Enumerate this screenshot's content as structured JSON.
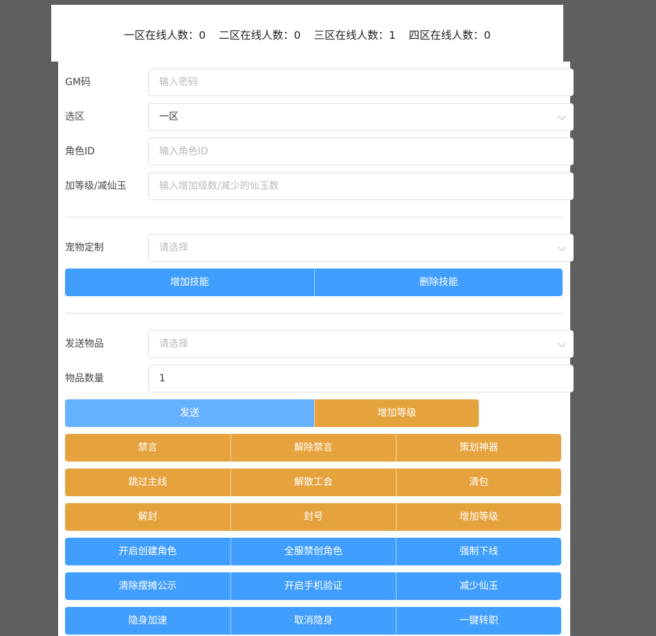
{
  "stats": [
    "一区在线人数：0",
    "二区在线人数：0",
    "三区在线人数：1",
    "四区在线人数：0"
  ],
  "form": {
    "gm_code": {
      "label": "GM码",
      "placeholder": "输入密码"
    },
    "zone": {
      "label": "选区",
      "value": "一区"
    },
    "role_id": {
      "label": "角色ID",
      "placeholder": "输入角色ID"
    },
    "level_jade": {
      "label": "加等级/减仙玉",
      "placeholder": "输入增加级数/减少的仙玉数"
    },
    "pet": {
      "label": "宠物定制",
      "placeholder": "请选择"
    },
    "item": {
      "label": "发送物品",
      "placeholder": "请选择"
    },
    "quantity": {
      "label": "物品数量",
      "value": "1"
    }
  },
  "skill_buttons": [
    "增加技能",
    "删除技能"
  ],
  "send_buttons": [
    "发送",
    "增加等级"
  ],
  "grid_buttons": [
    [
      "禁言",
      "解除禁言",
      "策划神器"
    ],
    [
      "跳过主线",
      "解散工会",
      "清包"
    ],
    [
      "解封",
      "封号",
      "增加等级"
    ],
    [
      "开启创建角色",
      "全服禁创角色",
      "强制下线"
    ],
    [
      "清除摆摊公示",
      "开启手机验证",
      "减少仙玉"
    ],
    [
      "隐身加速",
      "取消隐身",
      "一键转职"
    ]
  ],
  "colors": {
    "primary": "#409eff",
    "primary_light": "#66b1ff",
    "warning": "#e6a23c",
    "backdrop": "#5e5e5e"
  }
}
